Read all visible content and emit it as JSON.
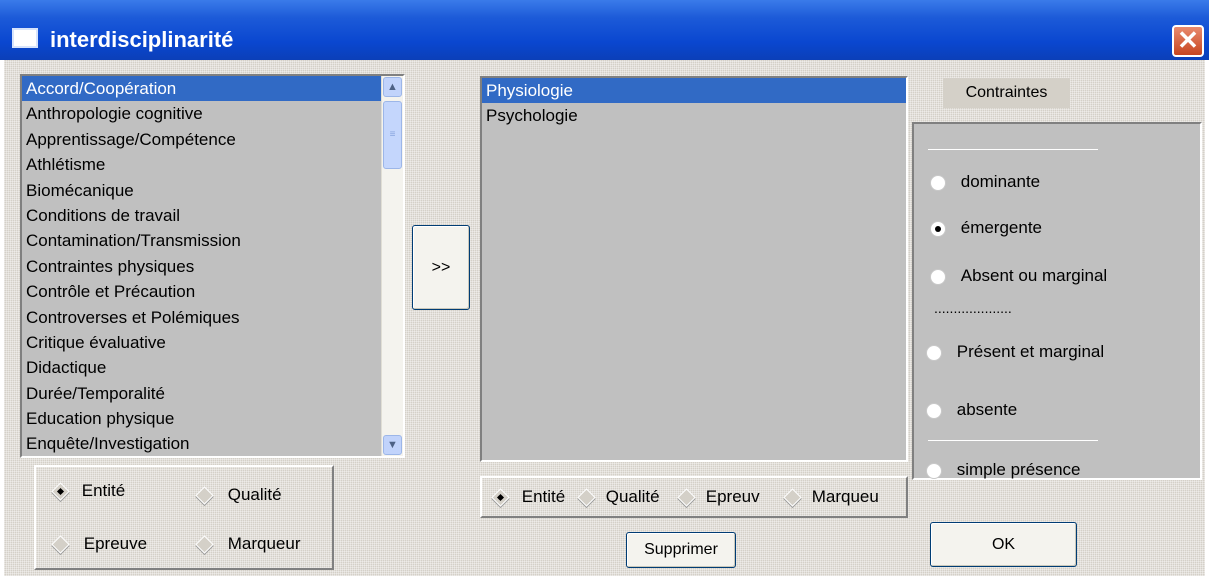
{
  "window": {
    "title": "interdisciplinarité",
    "close_label": "✕"
  },
  "left_list": {
    "selected_index": 0,
    "items": [
      "Accord/Coopération",
      "Anthropologie cognitive",
      "Apprentissage/Compétence",
      "Athlétisme",
      "Biomécanique",
      "Conditions de travail",
      "Contamination/Transmission",
      "Contraintes physiques",
      "Contrôle et Précaution",
      "Controverses et Polémiques",
      "Critique évaluative",
      "Didactique",
      "Durée/Temporalité",
      "Education physique",
      "Enquête/Investigation"
    ],
    "scroll_up_icon": "▲",
    "scroll_down_icon": "▼",
    "thumb_grip": "≡"
  },
  "transfer_button": {
    "label": ">>"
  },
  "right_list": {
    "selected_index": 0,
    "items": [
      "Physiologie",
      "Psychologie"
    ]
  },
  "left_filter": {
    "options": [
      {
        "label": "Entité",
        "checked": true
      },
      {
        "label": "Qualité",
        "checked": false
      },
      {
        "label": "Epreuve",
        "checked": false
      },
      {
        "label": "Marqueur",
        "checked": false
      }
    ]
  },
  "right_filter": {
    "options": [
      {
        "label": "Entité",
        "checked": true
      },
      {
        "label": "Qualité",
        "checked": false
      },
      {
        "label": "Epreuv",
        "checked": false
      },
      {
        "label": "Marqueu",
        "checked": false
      }
    ]
  },
  "delete_button": {
    "label": "Supprimer"
  },
  "constraints": {
    "title": "Contraintes",
    "options": [
      {
        "label": "dominante",
        "checked": false
      },
      {
        "label": "émergente",
        "checked": true
      },
      {
        "label": "Absent ou marginal",
        "checked": false
      },
      {
        "label": "Présent et marginal",
        "checked": false
      },
      {
        "label": "absente",
        "checked": false
      },
      {
        "label": "simple présence",
        "checked": false
      }
    ],
    "separator_dots": "...................."
  },
  "ok_button": {
    "label": "OK"
  },
  "colors": {
    "title_bar": "#0a47d0",
    "selection": "#316ac5",
    "list_bg": "#c0c0c0",
    "close_button": "#c7451f"
  }
}
